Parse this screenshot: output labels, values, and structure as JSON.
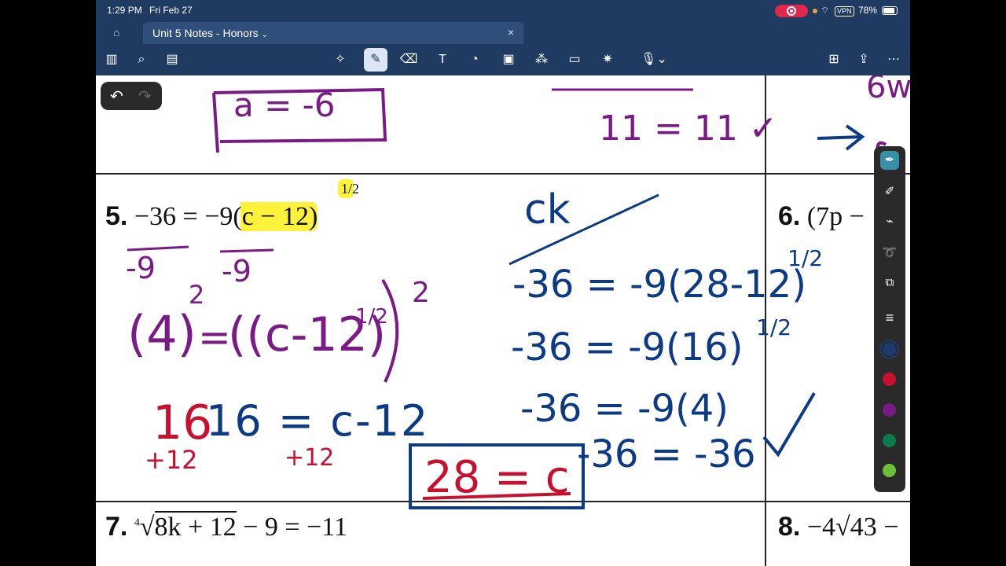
{
  "status": {
    "time": "1:29 PM",
    "date": "Fri Feb 27",
    "battery": "78%",
    "vpn": "VPN"
  },
  "tab": {
    "title": "Unit 5 Notes - Honors",
    "chevron": "⌄",
    "close": "×"
  },
  "toolbar": {
    "left_tools": [
      "sidebar-icon",
      "search-icon",
      "pages-icon"
    ],
    "center_tools": [
      "lasso-icon",
      "pen-icon",
      "eraser-icon",
      "text-icon",
      "shapes-icon",
      "image-icon",
      "elements-icon",
      "sticky-note-icon",
      "laser-icon",
      "mic-icon"
    ],
    "right_tools": [
      "add-page-icon",
      "share-icon",
      "more-icon"
    ]
  },
  "problems": {
    "p5": {
      "number": "5.",
      "equation": "−36 = −9(c − 12)",
      "exponent": "1/2"
    },
    "p6": {
      "number": "6.",
      "equation": "(7p −"
    },
    "p7": {
      "number": "7.",
      "index": "4",
      "radicand": "8k + 12",
      "rest": "− 9 = −11"
    },
    "p8": {
      "number": "8.",
      "equation": "−4√43 −"
    }
  },
  "handwriting": {
    "top_left": "a = -6",
    "top_mid": "11 = 11 ✓",
    "top_right": "6w",
    "check_label": "ck",
    "step1": "-36 = -9(28-12)",
    "step1_exp": "1/2",
    "step2": "-36 = -9(16)",
    "step2_exp": "1/2",
    "step3": "-36 = -9(4)",
    "step4": "-36 = -36",
    "div_left": "-9",
    "div_right": "-9",
    "square_left": "(4)",
    "square_right": "((c-12)",
    "square_exp": "2",
    "square_inner_exp": "1/2",
    "linear": "16 = c-12",
    "plus_left": "+12",
    "plus_right": "+12",
    "answer": "28 = c"
  },
  "colors": {
    "navy": "#1f3b62",
    "ink_blue": "#0d3a84",
    "ink_purple": "#7a1a86",
    "ink_red": "#c8102e",
    "highlight": "#fff23a"
  },
  "palette": {
    "tools": [
      "ink-pen-icon",
      "pencil-icon",
      "highlighter-icon",
      "lasso-icon",
      "shape-icon"
    ],
    "swatches": [
      "#1c3b6e",
      "#c8102e",
      "#7a1a86",
      "#0d7a4a",
      "#6bbf3a"
    ]
  }
}
